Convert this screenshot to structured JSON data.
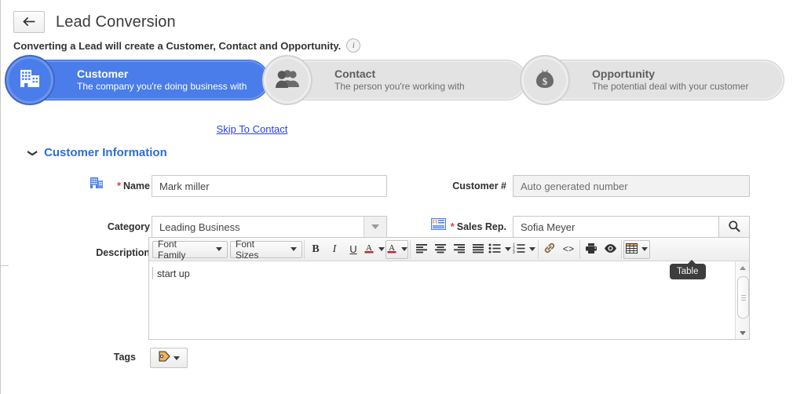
{
  "header": {
    "back_icon": "arrow-left-icon",
    "title": "Lead Conversion",
    "subtitle": "Converting a Lead will create a Customer, Contact and Opportunity.",
    "info_icon_label": "i"
  },
  "stepper": {
    "steps": [
      {
        "title": "Customer",
        "desc": "The company you're doing business with",
        "icon": "building-icon",
        "state": "active"
      },
      {
        "title": "Contact",
        "desc": "The person you're working with",
        "icon": "people-icon",
        "state": "inactive"
      },
      {
        "title": "Opportunity",
        "desc": "The potential deal with your customer",
        "icon": "money-bag-icon",
        "state": "inactive"
      }
    ],
    "active_color": "#4a7dea",
    "inactive_color": "#e3e3e3"
  },
  "skip_link": {
    "label": "Skip To Contact",
    "color": "#2b40e8"
  },
  "section": {
    "title": "Customer Information",
    "color": "#2b6fd4",
    "collapsed": false
  },
  "form": {
    "name": {
      "label": "Name",
      "required": true,
      "value": "Mark miller",
      "icon": "building-icon"
    },
    "customer_number": {
      "label": "Customer #",
      "required": false,
      "value": "Auto generated number",
      "readonly": true
    },
    "category": {
      "label": "Category",
      "required": false,
      "value": "Leading Business",
      "control": "dropdown"
    },
    "sales_rep": {
      "label": "Sales Rep.",
      "required": true,
      "value": "Sofia Meyer",
      "icon": "contact-card-icon",
      "control": "lookup",
      "button_icon": "search-icon"
    },
    "description": {
      "label": "Description",
      "value": "start up"
    },
    "tags": {
      "label": "Tags",
      "icon": "tag-icon"
    }
  },
  "editor": {
    "font_family": "Font Family",
    "font_sizes": "Font Sizes",
    "buttons": [
      {
        "name": "bold-button",
        "glyph": "B"
      },
      {
        "name": "italic-button",
        "glyph": "I"
      },
      {
        "name": "underline-button",
        "glyph": "U"
      },
      {
        "name": "text-color-button",
        "glyph": "A"
      },
      {
        "name": "background-color-button",
        "glyph": "A"
      },
      {
        "name": "align-left-button",
        "glyph": "align-left-icon"
      },
      {
        "name": "align-center-button",
        "glyph": "align-center-icon"
      },
      {
        "name": "align-right-button",
        "glyph": "align-right-icon"
      },
      {
        "name": "align-justify-button",
        "glyph": "align-justify-icon"
      },
      {
        "name": "bullet-list-button",
        "glyph": "bullet-list-icon"
      },
      {
        "name": "numbered-list-button",
        "glyph": "numbered-list-icon"
      },
      {
        "name": "link-button",
        "glyph": "link-icon"
      },
      {
        "name": "source-code-button",
        "glyph": "<>"
      },
      {
        "name": "print-button",
        "glyph": "printer-icon"
      },
      {
        "name": "preview-button",
        "glyph": "eye-icon"
      },
      {
        "name": "table-button",
        "glyph": "table-icon"
      }
    ],
    "content": "start up",
    "tooltip": "Table"
  }
}
